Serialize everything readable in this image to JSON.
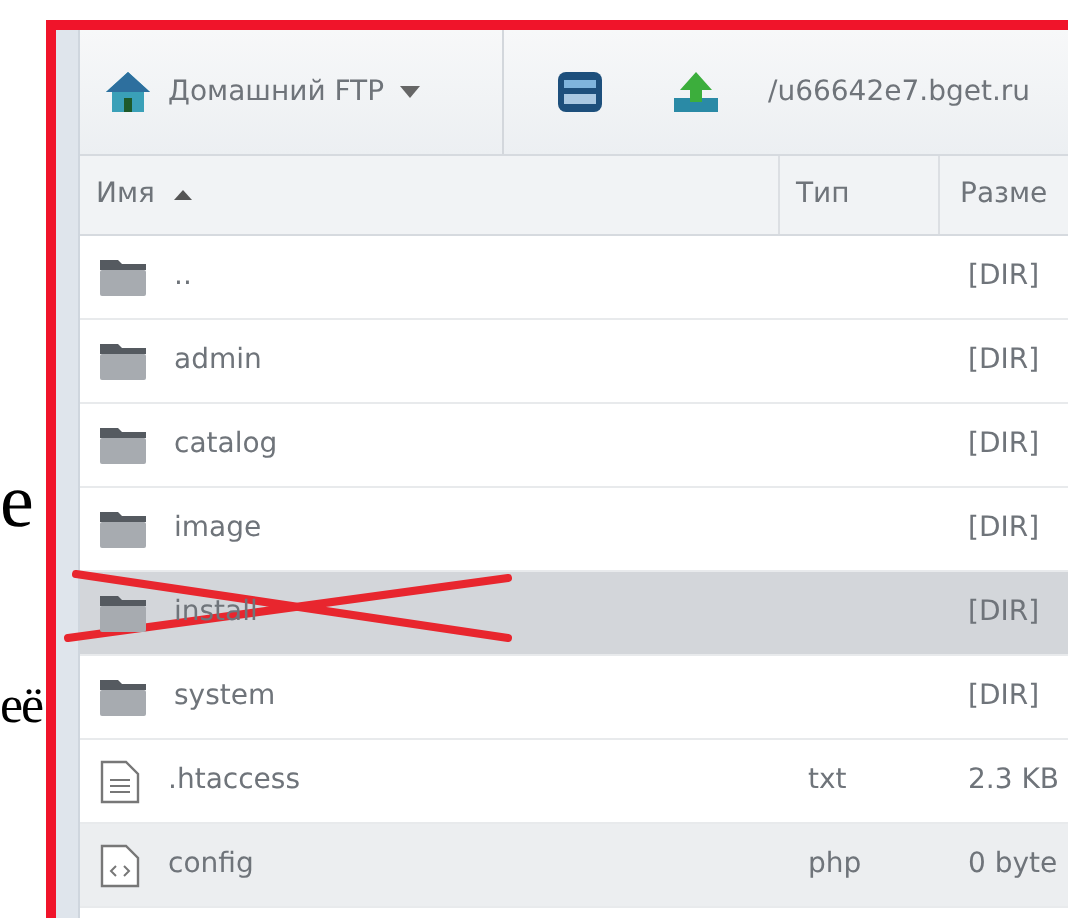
{
  "background_text": [
    "е",
    "её"
  ],
  "toolbar": {
    "connection": "Домашний FTP",
    "path": "/u66642e7.bget.ru"
  },
  "columns": [
    {
      "label": "Имя",
      "sorted": true
    },
    {
      "label": "Тип"
    },
    {
      "label": "Разме"
    }
  ],
  "rows": [
    {
      "kind": "folder",
      "name": "..",
      "size": "[DIR]",
      "selected": false,
      "hovered": false,
      "crossed_out": false
    },
    {
      "kind": "folder",
      "name": "admin",
      "size": "[DIR]",
      "selected": false,
      "hovered": false,
      "crossed_out": false
    },
    {
      "kind": "folder",
      "name": "catalog",
      "size": "[DIR]",
      "selected": false,
      "hovered": false,
      "crossed_out": false
    },
    {
      "kind": "folder",
      "name": "image",
      "size": "[DIR]",
      "selected": false,
      "hovered": false,
      "crossed_out": false
    },
    {
      "kind": "folder",
      "name": "install",
      "size": "[DIR]",
      "selected": true,
      "hovered": false,
      "crossed_out": true
    },
    {
      "kind": "folder",
      "name": "system",
      "size": "[DIR]",
      "selected": false,
      "hovered": false,
      "crossed_out": false
    },
    {
      "kind": "text",
      "name": ".htaccess",
      "type": "txt",
      "size": "2.3 KB",
      "selected": false,
      "hovered": false,
      "crossed_out": false
    },
    {
      "kind": "code",
      "name": "config",
      "type": "php",
      "size": "0 byte",
      "selected": false,
      "hovered": true,
      "crossed_out": false
    }
  ]
}
